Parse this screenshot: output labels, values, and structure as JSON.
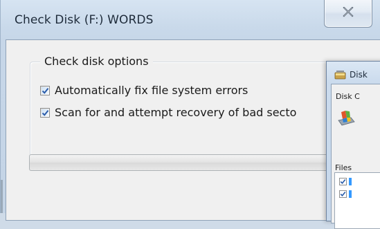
{
  "main_dialog": {
    "title": "Check Disk (F:) WORDS",
    "options_group": {
      "label": "Check disk options",
      "checkboxes": [
        {
          "label": "Automatically fix file system errors",
          "checked": true
        },
        {
          "label": "Scan for and attempt recovery of bad secto",
          "checked": true
        }
      ]
    },
    "progress": {
      "value": 0
    }
  },
  "secondary_dialog": {
    "title": "Disk",
    "group_label": "Disk C",
    "files_label": "Files",
    "files_list": [
      {
        "checked": true
      },
      {
        "checked": true
      }
    ]
  },
  "colors": {
    "accent": "#3399ff",
    "checkmark": "#2a5caa"
  }
}
